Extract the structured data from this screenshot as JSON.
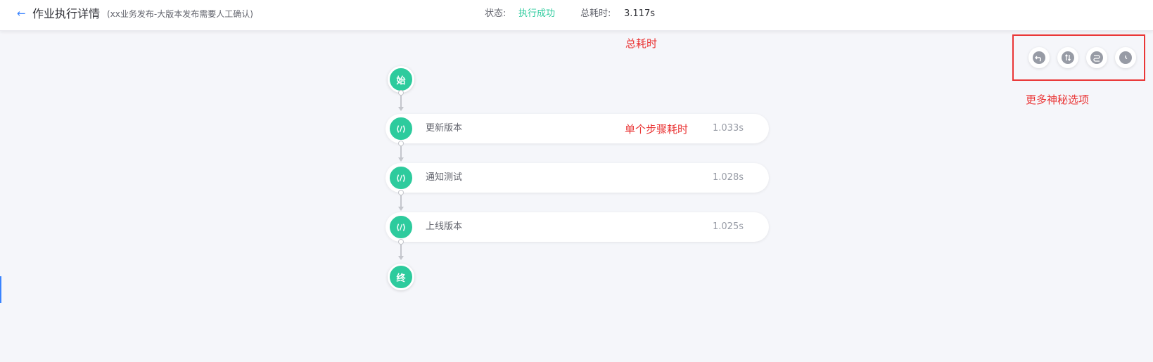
{
  "header": {
    "title": "作业执行详情",
    "subtitle": "(xx业务发布-大版本发布需要人工确认)",
    "status_label": "状态:",
    "status_value": "执行成功",
    "duration_label": "总耗时:",
    "duration_value": "3.117s"
  },
  "annotations": {
    "total_duration": "总耗时",
    "step_duration": "单个步骤耗时",
    "more_options": "更多神秘选项"
  },
  "flow": {
    "start_label": "始",
    "end_label": "终",
    "steps": [
      {
        "icon_text": "⟨/⟩",
        "name": "更新版本",
        "time": "1.033s"
      },
      {
        "icon_text": "⟨/⟩",
        "name": "通知测试",
        "time": "1.028s"
      },
      {
        "icon_text": "⟨/⟩",
        "name": "上线版本",
        "time": "1.025s"
      }
    ]
  },
  "toolbar": {
    "icons": [
      "rollback-icon",
      "view-variables-icon",
      "route-icon",
      "history-icon"
    ]
  },
  "colors": {
    "success": "#2dcb9d",
    "accent": "#3a84ff",
    "annotation": "#ea3636"
  }
}
